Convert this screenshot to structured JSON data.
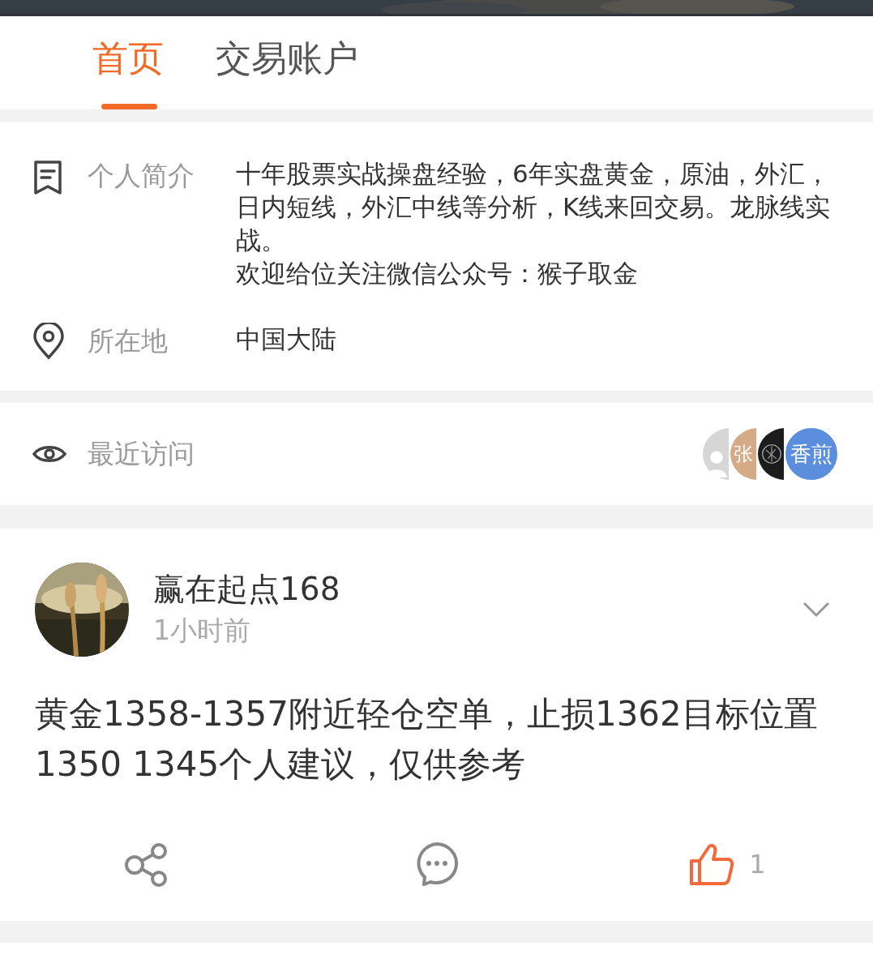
{
  "tabs": [
    {
      "label": "首页",
      "selected": true
    },
    {
      "label": "交易账户",
      "selected": false
    }
  ],
  "profile": [
    {
      "kind": "bio",
      "label": "个人简介",
      "lines": [
        "十年股票实战操盘经验，6年实盘黄金，原油，外汇，日内短线，外汇中线等分析，K线来回交易。龙脉线实战。",
        "欢迎给位关注微信公众号：猴子取金"
      ]
    },
    {
      "kind": "location",
      "label": "所在地",
      "lines": [
        "中国大陆"
      ]
    }
  ],
  "recent_visitors": {
    "label": "最近访问",
    "avatars": [
      {
        "kind": "silhouette",
        "color": "#d6d6d6"
      },
      {
        "kind": "text",
        "text": "张",
        "color": "#d4ab86"
      },
      {
        "kind": "emblem",
        "color": "#1c1c1c"
      },
      {
        "kind": "text",
        "text": "香煎",
        "color": "#5b8fde"
      }
    ]
  },
  "post": {
    "author": "赢在起点168",
    "time": "1小时前",
    "body": "黄金1358-1357附近轻仓空单，止损1362目标位置1350 1345个人建议，仅供参考",
    "likes": "1",
    "liked": true
  }
}
